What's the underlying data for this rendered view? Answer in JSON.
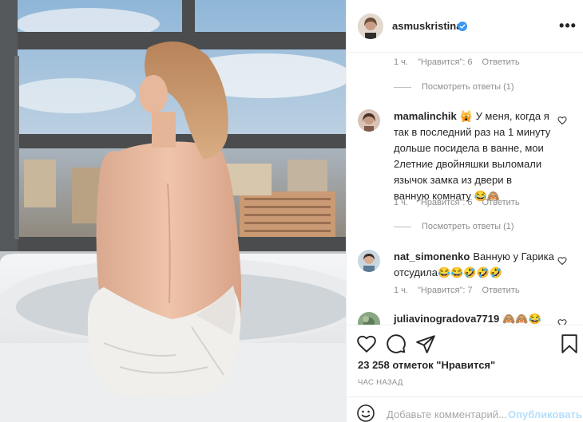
{
  "header": {
    "username": "asmuskristina",
    "more_label": "•••"
  },
  "comments": [
    {
      "meta": {
        "time": "1 ч.",
        "likes": "\"Нравится\": 6",
        "reply": "Ответить"
      },
      "view_replies": "Посмотреть ответы (1)"
    },
    {
      "username": "mamalinchik",
      "text_lines": [
        "🙀 У меня, когда я",
        "так в последний раз на 1 минуту",
        "дольше посидела в ванне, мои",
        "2летние двойняшки выломали",
        "язычок замка из двери в",
        "ванную комнату 😂🙈"
      ],
      "meta": {
        "time": "1 ч.",
        "likes": "\"Нравится\": 6",
        "reply": "Ответить"
      },
      "view_replies": "Посмотреть ответы (1)"
    },
    {
      "username": "nat_simonenko",
      "text_lines": [
        "Ванную у Гарика",
        "отсудила😂😂🤣🤣🤣"
      ],
      "meta": {
        "time": "1 ч.",
        "likes": "\"Нравится\": 7",
        "reply": "Ответить"
      }
    },
    {
      "username": "juliavinogradova7719",
      "text_lines": [
        "🙈🙈😂"
      ]
    }
  ],
  "post": {
    "likes": "23 258 отметок \"Нравится\"",
    "time_ago": "ЧАС НАЗАД"
  },
  "comment_input": {
    "placeholder": "Добавьте комментарий...",
    "publish": "Опубликовать"
  },
  "colors": {
    "verified": "#3897f0",
    "muted": "#8e8e8e",
    "publish": "#b2dffc",
    "border": "#efefef"
  },
  "icons": [
    "verified-badge-icon",
    "more-icon",
    "heart-icon",
    "comment-icon",
    "share-icon",
    "bookmark-icon",
    "emoji-icon"
  ]
}
